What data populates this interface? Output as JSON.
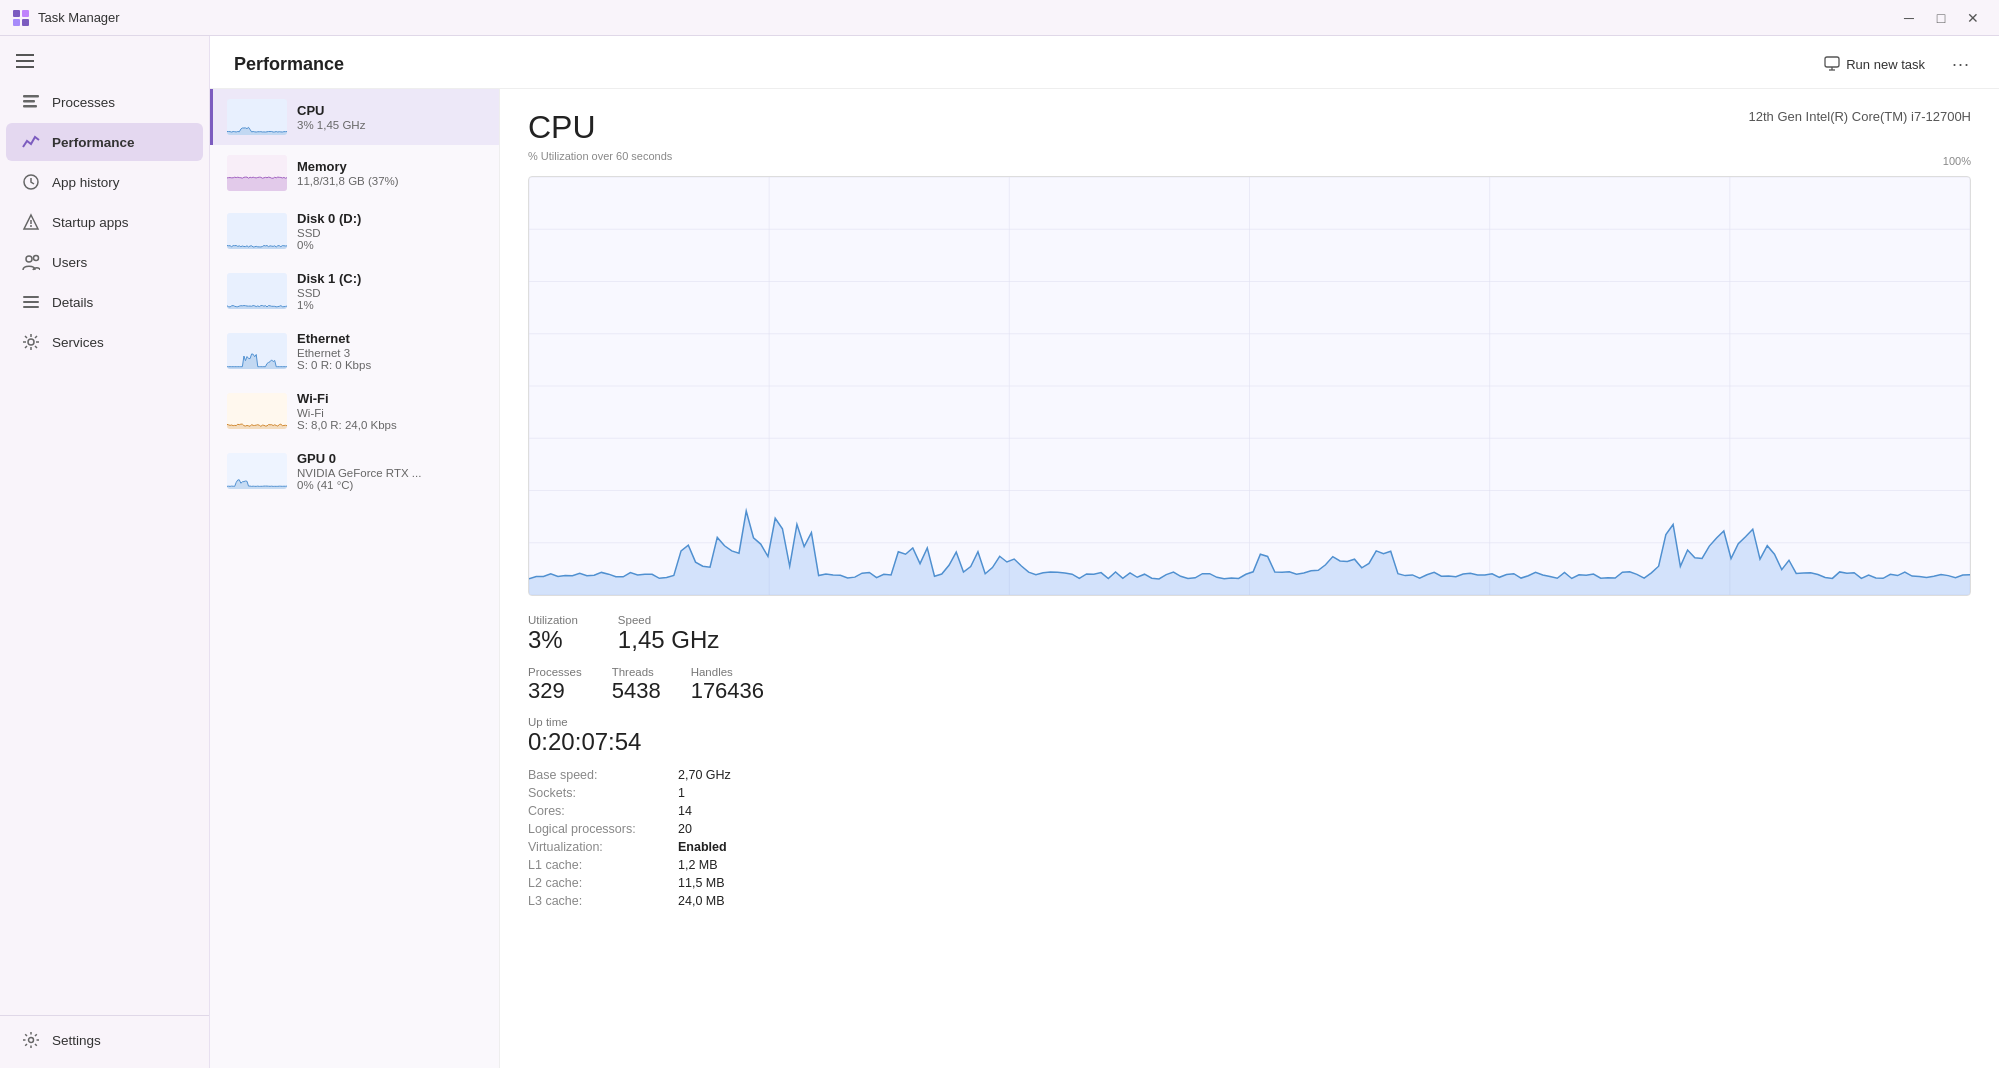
{
  "titleBar": {
    "icon": "task-manager-icon",
    "title": "Task Manager",
    "minimize": "─",
    "maximize": "□",
    "close": "✕"
  },
  "sidebar": {
    "hamburger": "☰",
    "items": [
      {
        "id": "processes",
        "label": "Processes",
        "icon": "processes-icon",
        "active": false
      },
      {
        "id": "performance",
        "label": "Performance",
        "icon": "performance-icon",
        "active": true
      },
      {
        "id": "app-history",
        "label": "App history",
        "icon": "app-history-icon",
        "active": false
      },
      {
        "id": "startup-apps",
        "label": "Startup apps",
        "icon": "startup-icon",
        "active": false
      },
      {
        "id": "users",
        "label": "Users",
        "icon": "users-icon",
        "active": false
      },
      {
        "id": "details",
        "label": "Details",
        "icon": "details-icon",
        "active": false
      },
      {
        "id": "services",
        "label": "Services",
        "icon": "services-icon",
        "active": false
      }
    ],
    "bottomItems": [
      {
        "id": "settings",
        "label": "Settings",
        "icon": "settings-icon"
      }
    ]
  },
  "header": {
    "title": "Performance",
    "runNewTask": "Run new task",
    "moreOptions": "..."
  },
  "perfSidebar": {
    "items": [
      {
        "id": "cpu",
        "name": "CPU",
        "sub": "3%  1,45 GHz",
        "active": true
      },
      {
        "id": "memory",
        "name": "Memory",
        "sub": "11,8/31,8 GB (37%)",
        "active": false
      },
      {
        "id": "disk0",
        "name": "Disk 0 (D:)",
        "sub": "SSD\n0%",
        "active": false
      },
      {
        "id": "disk1",
        "name": "Disk 1 (C:)",
        "sub": "SSD\n1%",
        "active": false
      },
      {
        "id": "ethernet",
        "name": "Ethernet",
        "sub": "Ethernet 3\nS: 0 R: 0 Kbps",
        "active": false
      },
      {
        "id": "wifi",
        "name": "Wi-Fi",
        "sub": "Wi-Fi\nS: 8,0 R: 24,0 Kbps",
        "active": false
      },
      {
        "id": "gpu0",
        "name": "GPU 0",
        "sub": "NVIDIA GeForce RTX ...\n0% (41 °C)",
        "active": false
      }
    ]
  },
  "cpuDetail": {
    "title": "CPU",
    "subtitle": "% Utilization over 60 seconds",
    "model": "12th Gen Intel(R) Core(TM) i7-12700H",
    "maxLabel": "100%",
    "utilization": {
      "label": "Utilization",
      "value": "3%"
    },
    "speed": {
      "label": "Speed",
      "value": "1,45 GHz"
    },
    "processes": {
      "label": "Processes",
      "value": "329"
    },
    "threads": {
      "label": "Threads",
      "value": "5438"
    },
    "handles": {
      "label": "Handles",
      "value": "176436"
    },
    "uptime": {
      "label": "Up time",
      "value": "0:20:07:54"
    },
    "specs": [
      {
        "key": "Base speed:",
        "value": "2,70 GHz"
      },
      {
        "key": "Sockets:",
        "value": "1"
      },
      {
        "key": "Cores:",
        "value": "14"
      },
      {
        "key": "Logical processors:",
        "value": "20"
      },
      {
        "key": "Virtualization:",
        "value": "Enabled",
        "bold": true
      },
      {
        "key": "L1 cache:",
        "value": "1,2 MB"
      },
      {
        "key": "L2 cache:",
        "value": "11,5 MB"
      },
      {
        "key": "L3 cache:",
        "value": "24,0 MB"
      }
    ]
  }
}
